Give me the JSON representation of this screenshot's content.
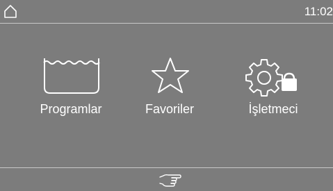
{
  "status_bar": {
    "home_icon": "home-icon",
    "time": "11:02"
  },
  "menu": {
    "items": [
      {
        "label": "Programlar",
        "icon": "wash-tub-icon"
      },
      {
        "label": "Favoriler",
        "icon": "star-icon"
      },
      {
        "label": "İşletmeci",
        "icon": "settings-lock-icon"
      }
    ]
  },
  "bottom_bar": {
    "icon": "hand-icon"
  },
  "colors": {
    "background": "#7c7c7c",
    "foreground": "#ffffff",
    "divider": "#c8c8c8"
  }
}
